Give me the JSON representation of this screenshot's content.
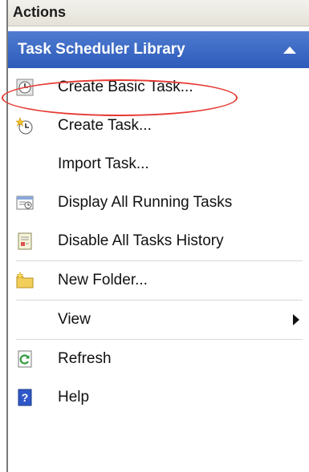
{
  "pane": {
    "title": "Actions"
  },
  "section": {
    "title": "Task Scheduler Library"
  },
  "items": [
    {
      "label": "Create Basic Task...",
      "icon": "clock-icon"
    },
    {
      "label": "Create Task...",
      "icon": "clock-star-icon"
    },
    {
      "label": "Import Task...",
      "icon": ""
    },
    {
      "label": "Display All Running Tasks",
      "icon": "running-tasks-icon"
    },
    {
      "label": "Disable All Tasks History",
      "icon": "history-icon"
    },
    {
      "label": "New Folder...",
      "icon": "new-folder-icon"
    },
    {
      "label": "View",
      "icon": ""
    },
    {
      "label": "Refresh",
      "icon": "refresh-icon"
    },
    {
      "label": "Help",
      "icon": "help-icon"
    }
  ],
  "colors": {
    "section_bg": "#3a67c4",
    "highlight": "#e63a33"
  }
}
